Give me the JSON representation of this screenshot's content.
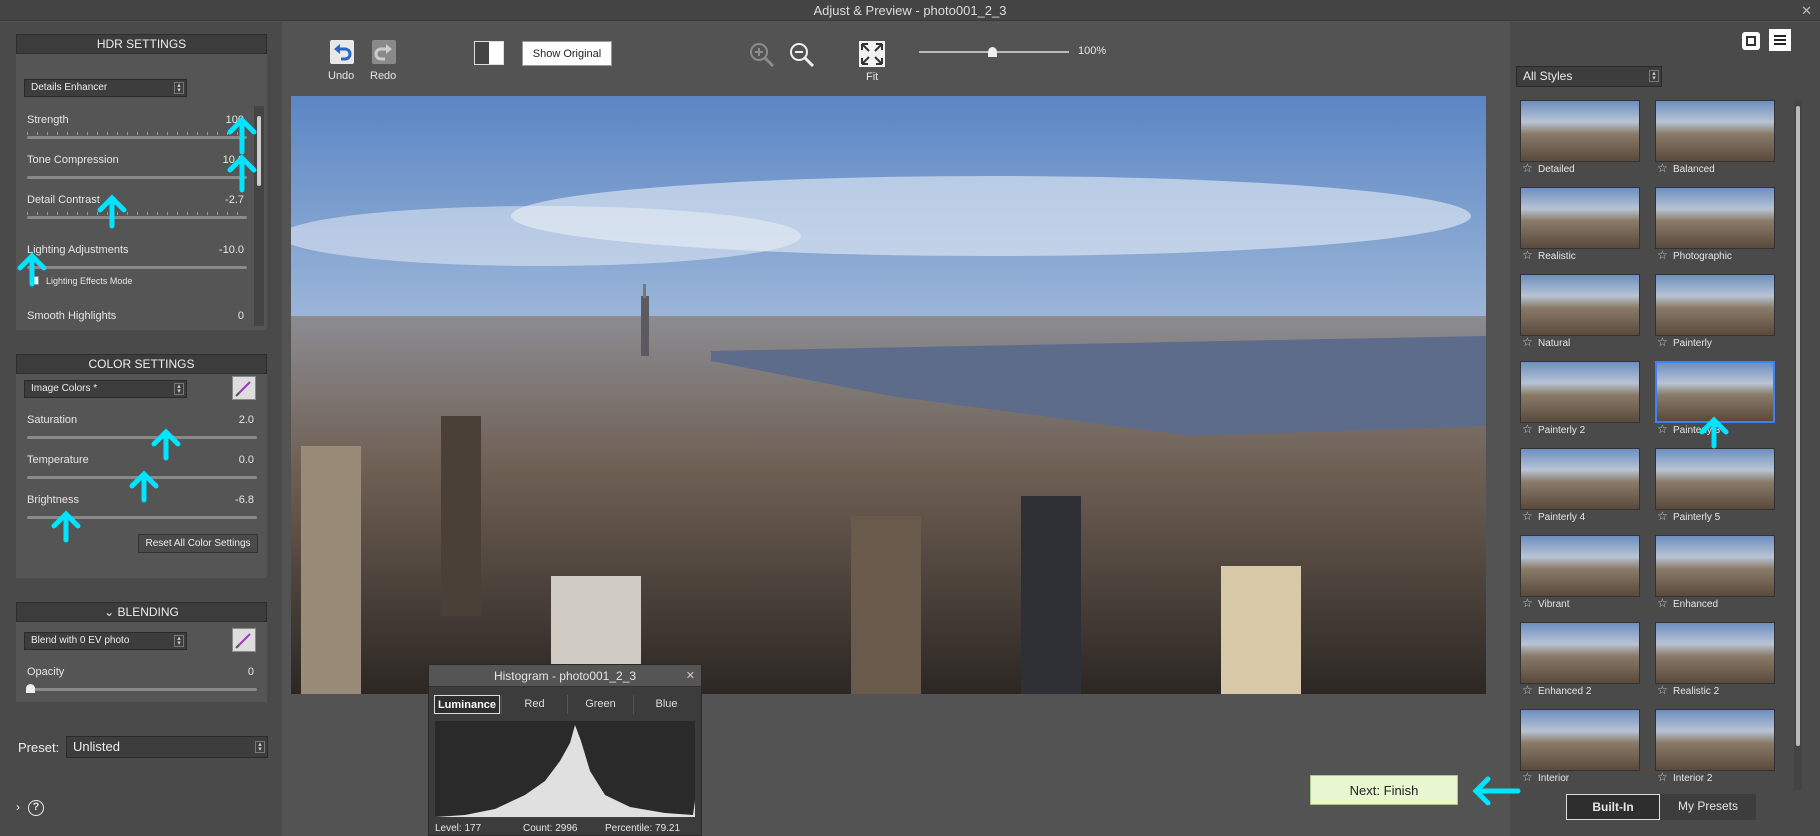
{
  "window": {
    "title": "Adjust & Preview - photo001_2_3",
    "close": "✕"
  },
  "hdr": {
    "heading": "HDR SETTINGS",
    "method": "Details Enhancer",
    "sliders": [
      {
        "label": "Strength",
        "value": "100"
      },
      {
        "label": "Tone Compression",
        "value": "10.0"
      },
      {
        "label": "Detail Contrast",
        "value": "-2.7"
      },
      {
        "label": "Lighting Adjustments",
        "value": "-10.0"
      },
      {
        "label": "Smooth Highlights",
        "value": "0"
      }
    ],
    "lighting_mode_label": "Lighting Effects Mode"
  },
  "color": {
    "heading": "COLOR SETTINGS",
    "mode": "Image Colors *",
    "sliders": [
      {
        "label": "Saturation",
        "value": "2.0"
      },
      {
        "label": "Temperature",
        "value": "0.0"
      },
      {
        "label": "Brightness",
        "value": "-6.8"
      }
    ],
    "reset_label": "Reset All Color Settings"
  },
  "blending": {
    "heading": "BLENDING",
    "mode": "Blend with 0 EV photo",
    "opacity_label": "Opacity",
    "opacity_value": "0"
  },
  "preset": {
    "label": "Preset:",
    "value": "Unlisted"
  },
  "help": "?",
  "toolbar": {
    "undo": "Undo",
    "redo": "Redo",
    "show_original": "Show Original",
    "fit": "Fit",
    "zoom_value": "100%"
  },
  "styles": {
    "filter": "All Styles",
    "items": [
      "Detailed",
      "Balanced",
      "Realistic",
      "Photographic",
      "Natural",
      "Painterly",
      "Painterly 2",
      "Painterly 3",
      "Painterly 4",
      "Painterly 5",
      "Vibrant",
      "Enhanced",
      "Enhanced 2",
      "Realistic 2",
      "Interior",
      "Interior 2"
    ],
    "tab_builtin": "Built-In",
    "tab_mypresets": "My Presets"
  },
  "next_button": "Next: Finish",
  "histogram": {
    "title": "Histogram - photo001_2_3",
    "close": "✕",
    "tabs": [
      "Luminance",
      "Red",
      "Green",
      "Blue"
    ],
    "level": "Level: 177",
    "count": "Count: 2996",
    "percentile": "Percentile: 79.21"
  },
  "colors": {
    "accent_cyan": "#00e5ff",
    "next_bg": "#e8f7cf",
    "selected_border": "#3b82f6"
  }
}
